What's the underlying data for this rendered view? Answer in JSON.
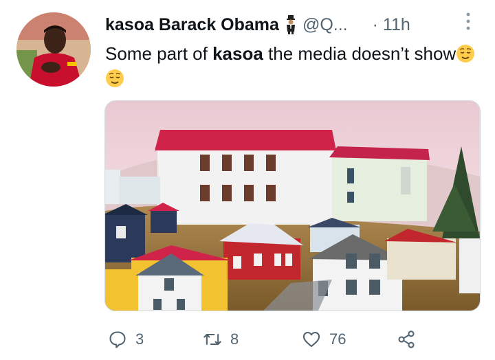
{
  "tweet": {
    "author_name": "kasoa Barack Obama",
    "author_badge_icon": "man-in-suit-emoji",
    "handle": "@Q...",
    "time": "11h",
    "text_before": "Some part of ",
    "text_bold": "kasoa",
    "text_after": " the media doesn’t show",
    "emojis": [
      "relieved-face",
      "relieved-face"
    ]
  },
  "actions": {
    "reply_count": "3",
    "retweet_count": "8",
    "like_count": "76"
  },
  "colors": {
    "text": "#0f1419",
    "secondary": "#536471",
    "roof_red": "#d0234a",
    "sky": "#f3dce0"
  }
}
